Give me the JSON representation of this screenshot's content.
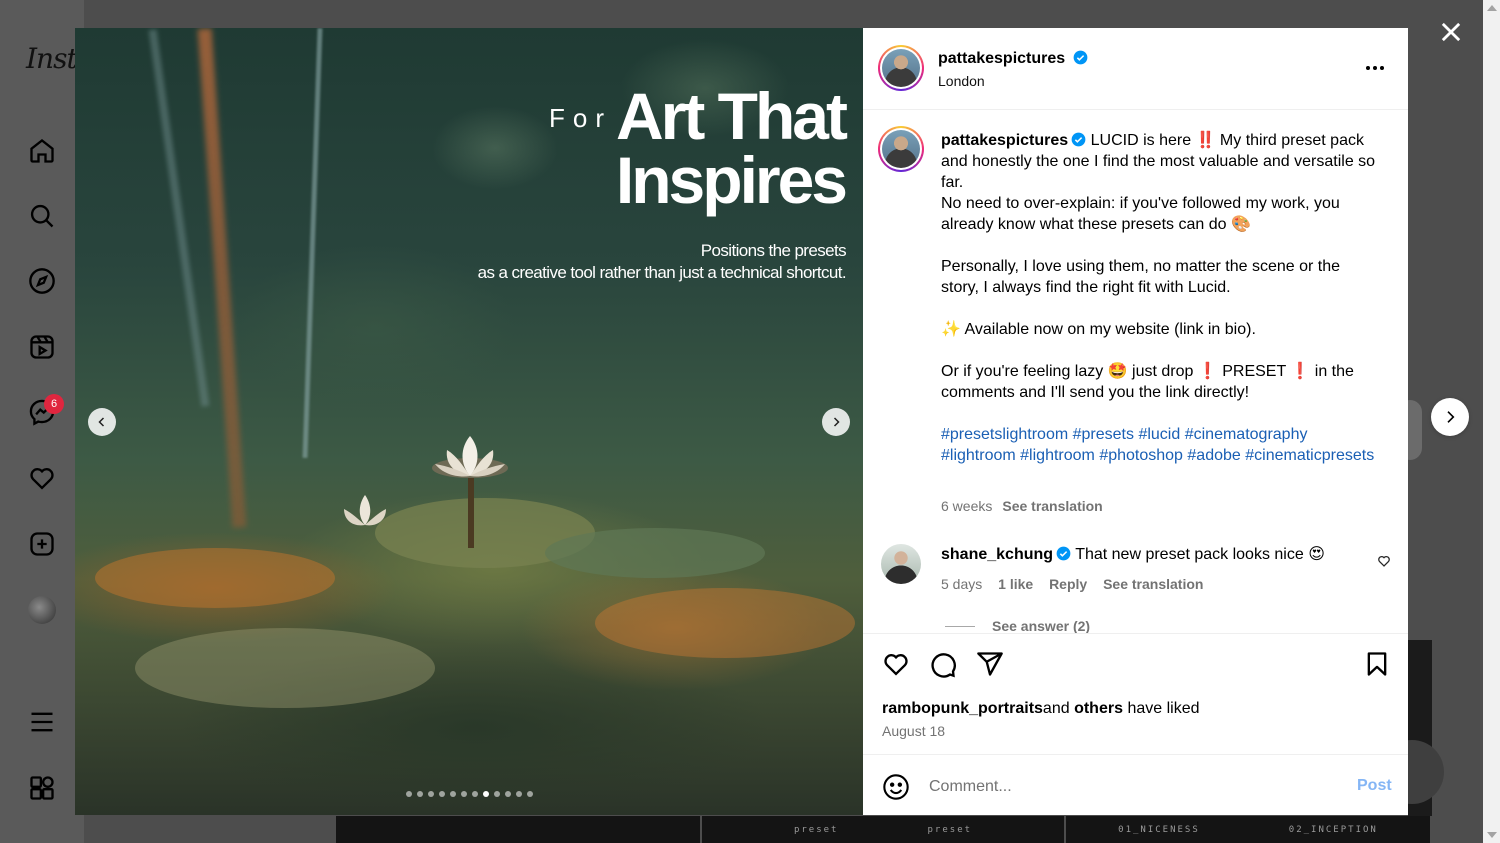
{
  "background": {
    "logo_text": "Inst",
    "notification_count": "6",
    "thumb_labels": [
      "preset",
      "preset",
      "01_NICENESS",
      "02_INCEPTION"
    ]
  },
  "media": {
    "title_for": "For",
    "title_art": "Art That",
    "title_inspires": "Inspires",
    "subtitle_line1": "Positions the presets",
    "subtitle_line2": "as a creative tool rather than just a technical shortcut.",
    "slide_count": 12,
    "active_slide": 8
  },
  "post": {
    "username": "pattakespictures",
    "location": "London",
    "caption": {
      "line1_rest": "LUCID is here ‼️  My third preset pack and honestly the one I find the most valuable and versatile so far.",
      "line2": "No need to over-explain: if you've followed my work, you already know what these presets can do 🎨",
      "line3": "Personally, I love using them, no matter the scene or the story, I always find the right fit with Lucid.",
      "line4": "✨ Available now on my website (link in bio).",
      "line5": "Or if you're feeling lazy 🤩 just drop ❗ PRESET ❗ in the comments and I'll send you the link directly!",
      "hashtags": [
        "#presetslightroom",
        "#presets",
        "#lucid",
        "#cinematography",
        "#lightroom",
        "#lightroom",
        "#photoshop",
        "#adobe",
        "#cinematicpresets"
      ]
    },
    "age": "6 weeks",
    "see_translation": "See translation",
    "comment": {
      "username": "shane_kchung",
      "text": "That new preset pack looks nice 😍",
      "age": "5 days",
      "likes": "1 like",
      "reply": "Reply",
      "see_translation": "See translation",
      "see_answer": "See answer (2)"
    },
    "liked_by_user": "rambopunk_portraits",
    "liked_by_and": "and",
    "liked_by_others": "others",
    "liked_by_suffix": "have liked",
    "date": "August 18",
    "comment_placeholder": "Comment...",
    "post_button": "Post"
  },
  "colors": {
    "link": "#1a5fb4",
    "post_disabled": "#85b6f5",
    "verified": "#0095f6",
    "badge": "#e0263f"
  }
}
